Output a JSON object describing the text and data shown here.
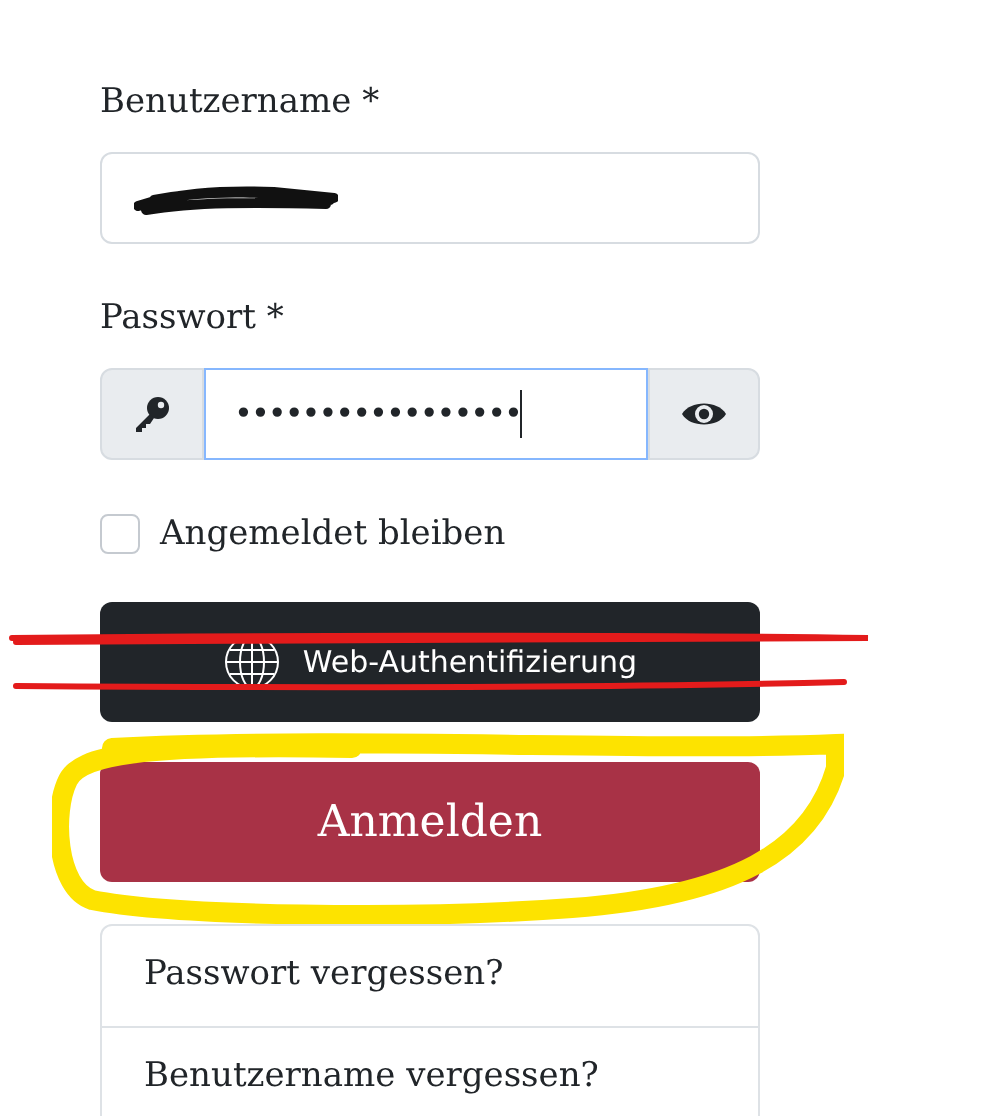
{
  "username": {
    "label": "Benutzername *",
    "redacted": true
  },
  "password": {
    "label": "Passwort *",
    "value": "•••••••••••••••••",
    "focused": true
  },
  "remember": {
    "label": "Angemeldet bleiben",
    "checked": false
  },
  "buttons": [
    {
      "kind": "webauthn",
      "label": "Web-Authentifizierung",
      "struck": true
    },
    {
      "kind": "primary",
      "label": "Anmelden",
      "circled": true
    }
  ],
  "links": [
    {
      "label": "Passwort vergessen?"
    },
    {
      "label": "Benutzername vergessen?"
    }
  ]
}
